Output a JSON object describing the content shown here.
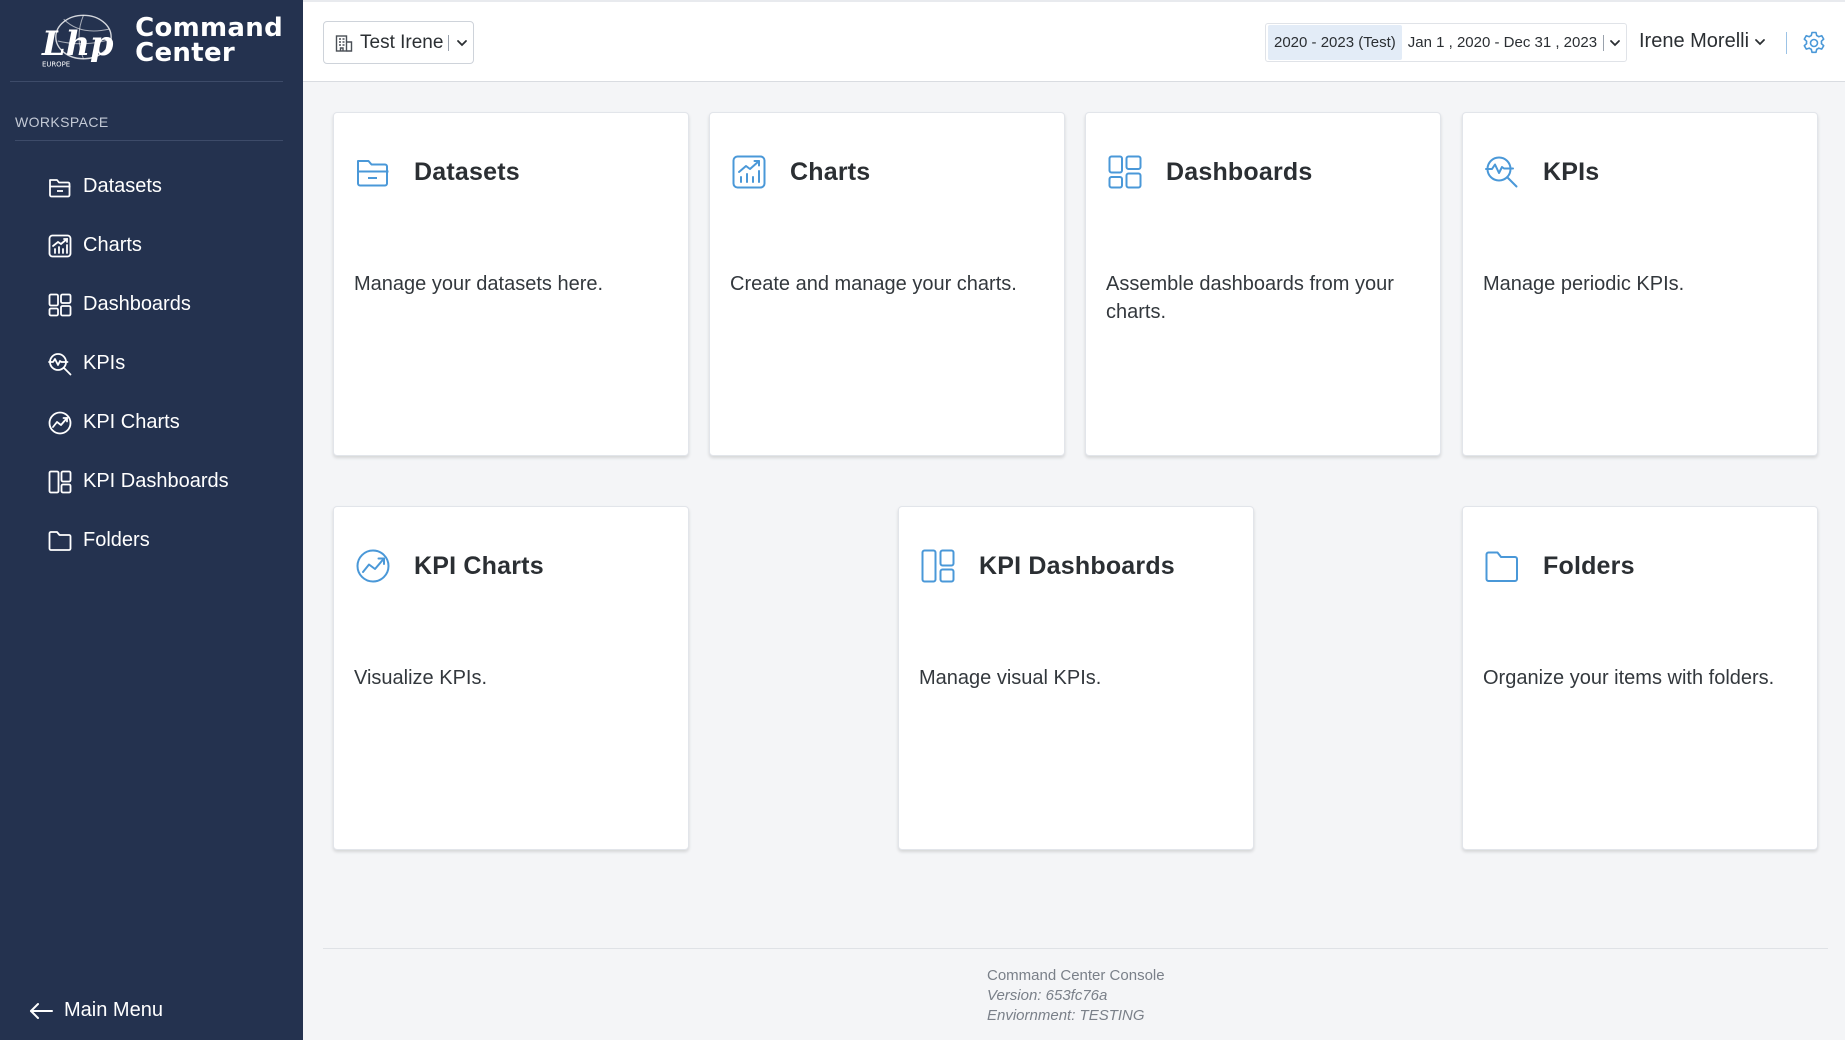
{
  "brand": {
    "logo_text": "Lhp",
    "logo_subtext": "EUROPE",
    "title_line1": "Command",
    "title_line2": "Center"
  },
  "sidebar": {
    "section_label": "WORKSPACE",
    "items": [
      {
        "label": "Datasets",
        "icon": "folder-open-icon"
      },
      {
        "label": "Charts",
        "icon": "chart-icon"
      },
      {
        "label": "Dashboards",
        "icon": "dashboard-icon"
      },
      {
        "label": "KPIs",
        "icon": "kpi-search-icon"
      },
      {
        "label": "KPI Charts",
        "icon": "kpi-chart-icon"
      },
      {
        "label": "KPI Dashboards",
        "icon": "kpi-dashboard-icon"
      },
      {
        "label": "Folders",
        "icon": "folder-icon"
      }
    ],
    "main_menu_label": "Main Menu"
  },
  "topbar": {
    "org_selected": "Test Irene",
    "date_preset": "2020 - 2023 (Test)",
    "date_range": "Jan 1 , 2020 - Dec 31 , 2023",
    "user_name": "Irene Morelli"
  },
  "cards": [
    {
      "title": "Datasets",
      "description": "Manage your datasets here.",
      "icon": "folder-open-icon"
    },
    {
      "title": "Charts",
      "description": "Create and manage your charts.",
      "icon": "chart-icon"
    },
    {
      "title": "Dashboards",
      "description": "Assemble dashboards from your charts.",
      "icon": "dashboard-icon"
    },
    {
      "title": "KPIs",
      "description": "Manage periodic KPIs.",
      "icon": "kpi-search-icon"
    },
    {
      "title": "KPI Charts",
      "description": "Visualize KPIs.",
      "icon": "kpi-chart-icon"
    },
    {
      "title": "KPI Dashboards",
      "description": "Manage visual KPIs.",
      "icon": "kpi-dashboard-icon"
    },
    {
      "title": "Folders",
      "description": "Organize your items with folders.",
      "icon": "folder-icon"
    }
  ],
  "footer": {
    "app_name": "Command Center Console",
    "version": "Version: 653fc76a",
    "environment": "Enviornment: TESTING"
  },
  "colors": {
    "sidebar_bg": "#24324f",
    "accent": "#4a98d8",
    "page_bg": "#f4f5f7",
    "date_badge_bg": "#e3ecf7"
  }
}
